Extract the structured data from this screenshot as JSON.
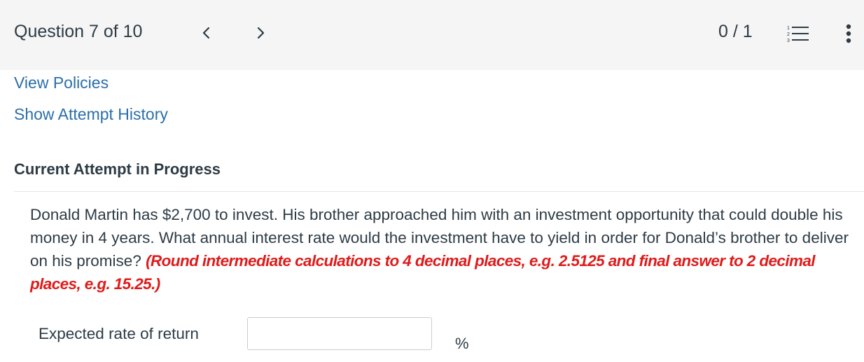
{
  "header": {
    "question_label": "Question 7 of 10",
    "score": "0 / 1",
    "icons": {
      "prev": "chevron-left-icon",
      "next": "chevron-right-icon",
      "list": "numbered-list-icon",
      "more": "more-vertical-icon"
    }
  },
  "links": {
    "view_policies": "View Policies",
    "show_attempt_history": "Show Attempt History"
  },
  "attempt": {
    "title": "Current Attempt in Progress"
  },
  "question": {
    "text": "Donald Martin has $2,700 to invest. His brother approached him with an investment opportunity that could double his money in 4 years. What annual interest rate would the investment have to yield in order for Donald’s brother to deliver on his promise?",
    "instruction": "(Round intermediate calculations to 4 decimal places, e.g. 2.5125 and final answer to 2 decimal places, e.g. 15.25.)"
  },
  "answer": {
    "label": "Expected rate of return",
    "value": "",
    "unit": "%"
  },
  "colors": {
    "header_bg": "#f5f5f5",
    "link": "#2b6fa9",
    "instruction": "#e01a1a",
    "text": "#2d3b45"
  }
}
